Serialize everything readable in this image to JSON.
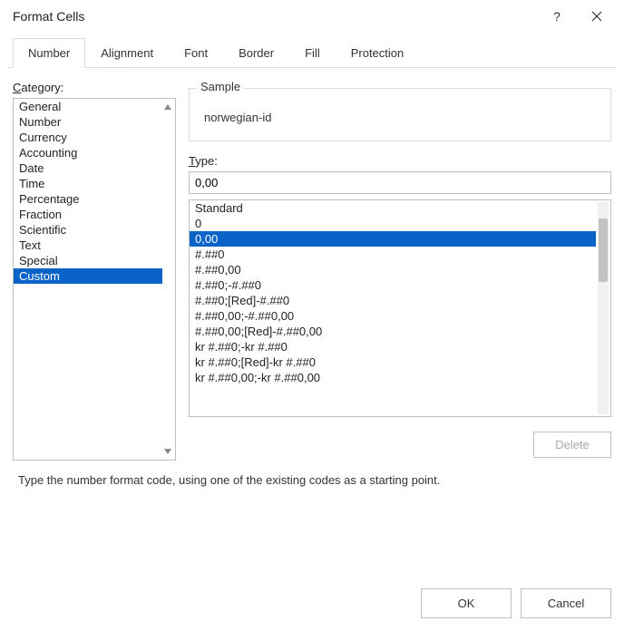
{
  "title": "Format Cells",
  "tabs": [
    "Number",
    "Alignment",
    "Font",
    "Border",
    "Fill",
    "Protection"
  ],
  "active_tab": 0,
  "category_label_initial": "C",
  "category_label_rest": "ategory:",
  "categories": [
    "General",
    "Number",
    "Currency",
    "Accounting",
    "Date",
    "Time",
    "Percentage",
    "Fraction",
    "Scientific",
    "Text",
    "Special",
    "Custom"
  ],
  "category_selected": 11,
  "sample_label": "Sample",
  "sample_value": "norwegian-id",
  "type_label_initial": "T",
  "type_label_rest": "ype:",
  "type_value": "0,00",
  "formats": [
    "Standard",
    "0",
    "0,00",
    "#.##0",
    "#.##0,00",
    "#.##0;-#.##0",
    "#.##0;[Red]-#.##0",
    "#.##0,00;-#.##0,00",
    "#.##0,00;[Red]-#.##0,00",
    "kr #.##0;-kr #.##0",
    "kr #.##0;[Red]-kr #.##0",
    "kr #.##0,00;-kr #.##0,00"
  ],
  "format_selected": 2,
  "delete_label": "Delete",
  "hint": "Type the number format code, using one of the existing codes as a starting point.",
  "ok_label": "OK",
  "cancel_label": "Cancel"
}
